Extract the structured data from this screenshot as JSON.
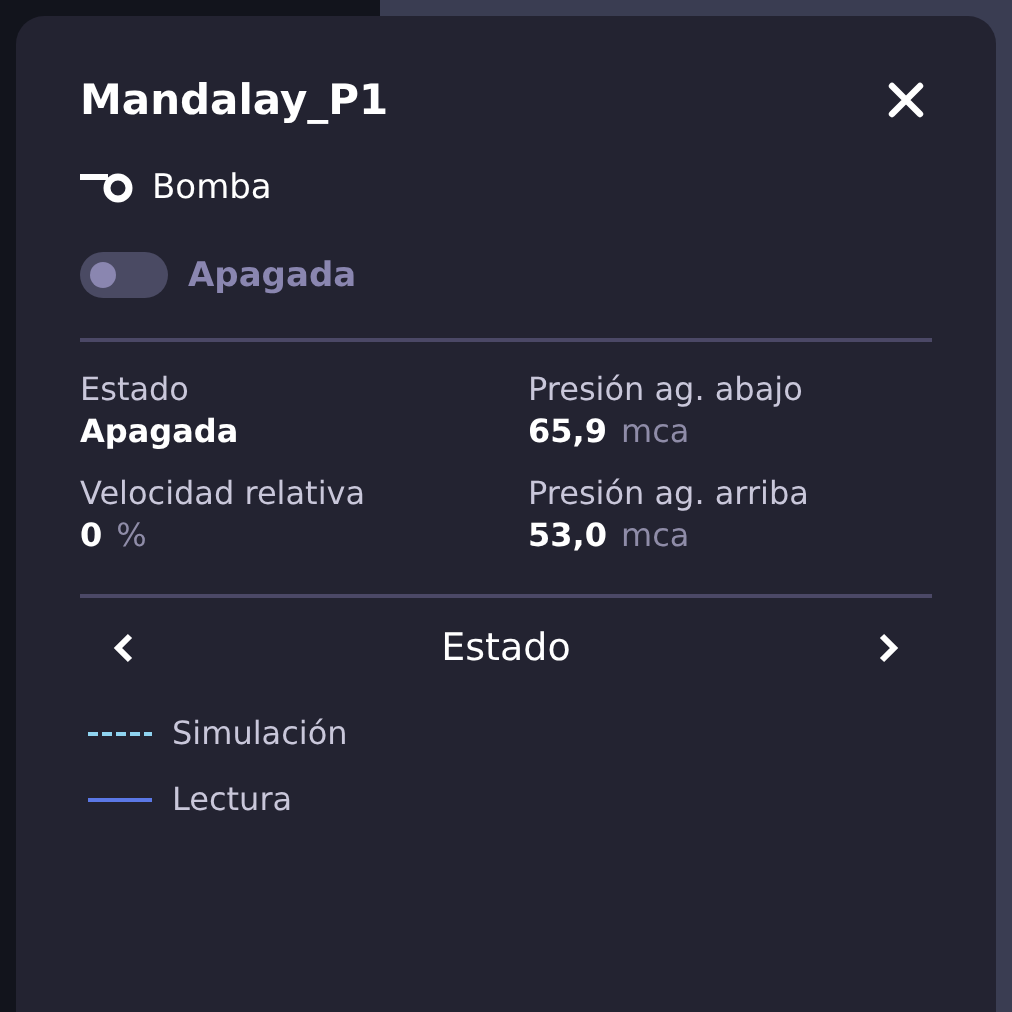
{
  "panel": {
    "title": "Mandalay_P1",
    "type_label": "Bomba"
  },
  "toggle": {
    "on": false,
    "label": "Apagada"
  },
  "stats": [
    {
      "label": "Estado",
      "value": "Apagada"
    },
    {
      "label": "Presión ag. abajo",
      "value": "65,9",
      "unit": "mca"
    },
    {
      "label": "Velocidad relativa",
      "value": "0",
      "unit": "%"
    },
    {
      "label": "Presión ag. arriba",
      "value": "53,0",
      "unit": "mca"
    }
  ],
  "chart_nav": {
    "title": "Estado"
  },
  "legend": [
    {
      "label": "Simulación",
      "kind": "dashed",
      "color": "#8fd3f0"
    },
    {
      "label": "Lectura",
      "kind": "solid",
      "color": "#5b78e6"
    }
  ]
}
